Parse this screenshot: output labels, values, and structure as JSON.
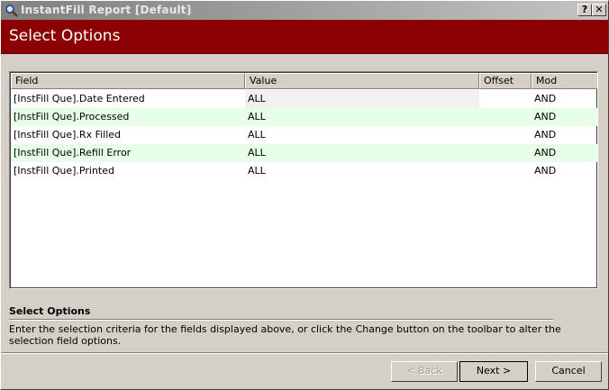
{
  "window": {
    "title": "InstantFill Report [Default]",
    "help_label": "?",
    "close_label": "✕"
  },
  "header": {
    "title": "Select Options",
    "color": "#8b0000"
  },
  "grid": {
    "columns": [
      "Field",
      "Value",
      "Offset",
      "Mod"
    ],
    "rows": [
      {
        "field": "[InstFill Que].Date Entered",
        "value": "ALL",
        "offset": "",
        "mod": "AND"
      },
      {
        "field": "[InstFill Que].Processed",
        "value": "ALL",
        "offset": "",
        "mod": "AND"
      },
      {
        "field": "[InstFill Que].Rx Filled",
        "value": "ALL",
        "offset": "",
        "mod": "AND"
      },
      {
        "field": "[InstFill Que].Refill Error",
        "value": "ALL",
        "offset": "",
        "mod": "AND"
      },
      {
        "field": "[InstFill Que].Printed",
        "value": "ALL",
        "offset": "",
        "mod": "AND"
      }
    ],
    "alt_row_color": "#e6ffe6"
  },
  "description": {
    "title": "Select Options",
    "text": "Enter the selection criteria for the fields displayed above, or click the Change button on the toolbar to alter the selection field options."
  },
  "buttons": {
    "back": "< Back",
    "next": "Next >",
    "cancel": "Cancel"
  },
  "icons": {
    "app": "magnifier-icon"
  }
}
